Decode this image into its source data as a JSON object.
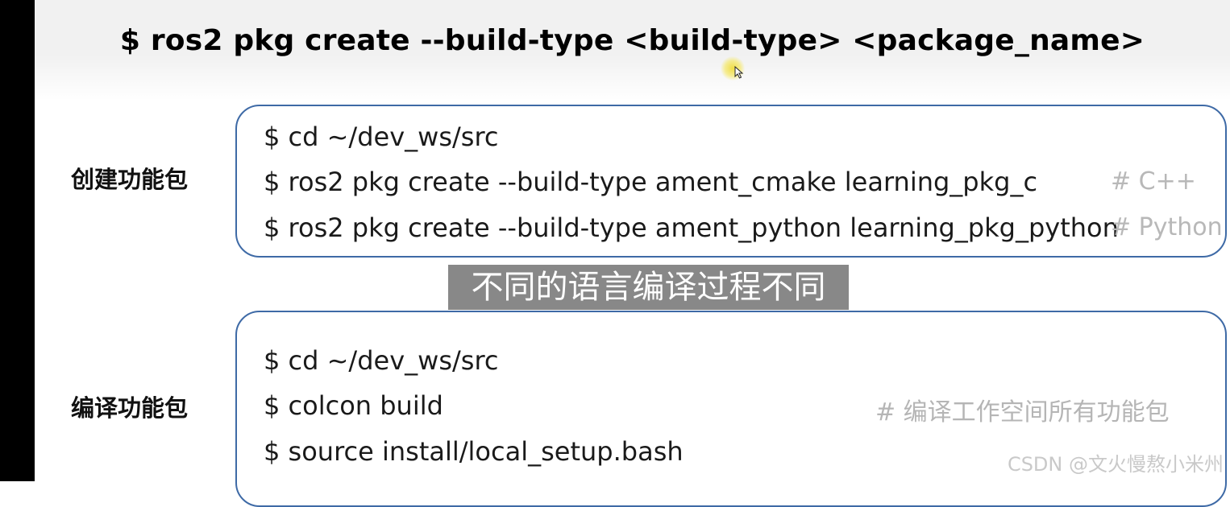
{
  "title": "$ ros2 pkg create --build-type <build-type> <package_name>",
  "create_section": {
    "label": "创建功能包",
    "lines": [
      "$ cd ~/dev_ws/src",
      "$ ros2 pkg create --build-type ament_cmake learning_pkg_c",
      "$ ros2 pkg create --build-type ament_python learning_pkg_python"
    ],
    "comments": [
      "# C++",
      "# Python"
    ]
  },
  "subtitle": "不同的语言编译过程不同",
  "build_section": {
    "label": "编译功能包",
    "lines": [
      "$ cd ~/dev_ws/src",
      "$ colcon build",
      "$ source install/local_setup.bash"
    ],
    "comments": [
      "# 编译工作空间所有功能包"
    ]
  },
  "watermark": "CSDN @文火慢熬小米州",
  "colors": {
    "box_border": "#3e6aa6",
    "comment": "#b8b8b8",
    "cursor_highlight": "#f0dc3c"
  }
}
